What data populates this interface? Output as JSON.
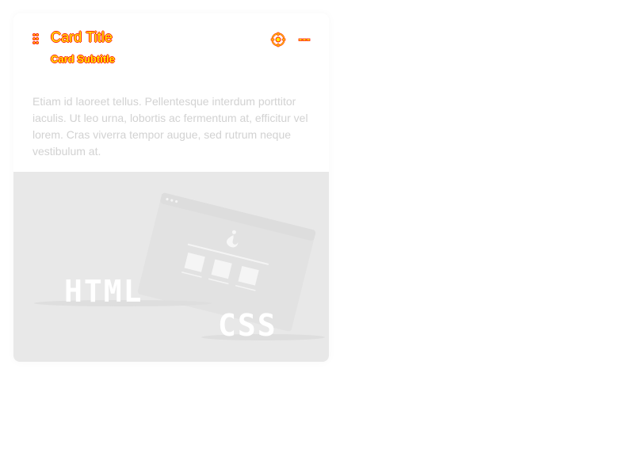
{
  "card": {
    "title": "Card Title",
    "subtitle": "Card Subtitle",
    "body": "Etiam id laoreet tellus. Pellentesque interdum porttitor iaculis. Ut leo urna, lobortis ac fermentum at, efficitur vel lorem. Cras viverra tempor augue, sed rutrum neque vestibulum at.",
    "media": {
      "left_label": "HTML",
      "right_label": "CSS"
    },
    "icons": {
      "drag": "drag-handle-icon",
      "settings": "settings-icon",
      "more": "more-icon"
    }
  },
  "colors": {
    "title_fill": "#ffea00",
    "title_outline": "#ff1a00",
    "body_text": "#d2d2d2",
    "media_bg": "#e8e8e8"
  }
}
